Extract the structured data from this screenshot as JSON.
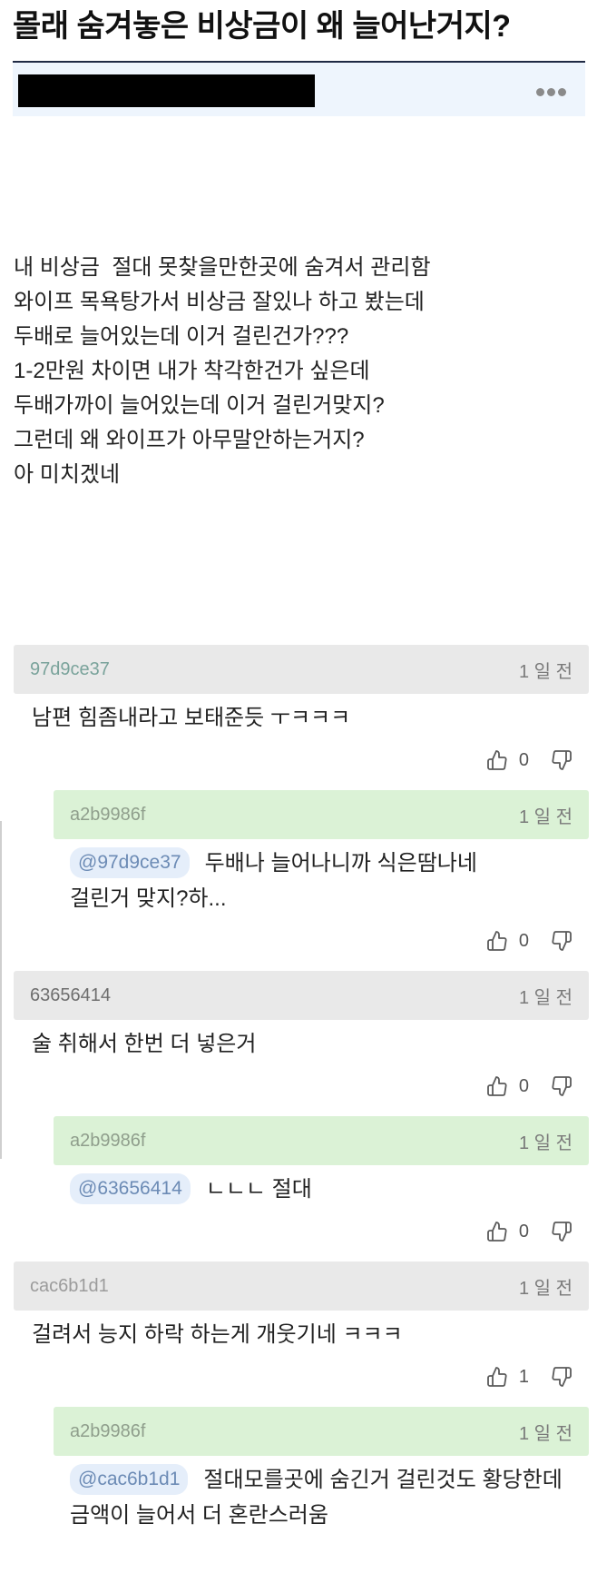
{
  "post": {
    "title": "몰래 숨겨놓은 비상금이 왜 늘어난거지?",
    "body_lines": [
      "내 비상금  절대 못찾을만한곳에 숨겨서 관리함",
      "와이프 목욕탕가서 비상금 잘있나 하고 봤는데",
      "두배로 늘어있는데 이거 걸린건가???",
      "1-2만원 차이면 내가 착각한건가 싶은데",
      "두배가까이 늘어있는데 이거 걸린거맞지?",
      "그런데 왜 와이프가 아무말안하는거지?",
      "아 미치겠네"
    ]
  },
  "icons": {
    "more": "more-dots-icon",
    "like": "thumbs-up-icon",
    "dislike": "thumbs-down-icon"
  },
  "colors": {
    "title_rule": "#1f2a44",
    "header_bar": "#eef5fd",
    "redaction": "#000000",
    "comment_bar": "#e9e9e9",
    "reply_bar": "#dbf2d6",
    "mention_bg": "#e5eefa",
    "mention_text": "#6c8bb5",
    "time_text": "#7a7a7a"
  },
  "comments": [
    {
      "author": "97d9ce37",
      "author_color": "#7aa39b",
      "time": "1 일 전",
      "text": "남편 힘좀내라고 보태준듯 ㅜㅋㅋㅋ",
      "likes": "0",
      "replies": [
        {
          "author": "a2b9986f",
          "author_color": "#8f9e8c",
          "time": "1 일 전",
          "mention": "@97d9ce37",
          "text": "두배나 늘어나니까 식은땀나네\n걸린거 맞지?하...",
          "likes": "0"
        }
      ]
    },
    {
      "author": "63656414",
      "author_color": "#6e6e6e",
      "time": "1 일 전",
      "text": "술 취해서 한번 더 넣은거",
      "likes": "0",
      "replies": [
        {
          "author": "a2b9986f",
          "author_color": "#8f9e8c",
          "time": "1 일 전",
          "mention": "@63656414",
          "text": "ㄴㄴㄴ 절대",
          "likes": "0"
        }
      ]
    },
    {
      "author": "cac6b1d1",
      "author_color": "#9b9b9b",
      "time": "1 일 전",
      "text": "걸려서 능지 하락 하는게 개웃기네 ㅋㅋㅋ",
      "likes": "1",
      "replies": [
        {
          "author": "a2b9986f",
          "author_color": "#8f9e8c",
          "time": "1 일 전",
          "mention": "@cac6b1d1",
          "text": "절대모를곳에 숨긴거 걸린것도 황당한데\n금액이 늘어서 더 혼란스러움"
        }
      ]
    }
  ]
}
